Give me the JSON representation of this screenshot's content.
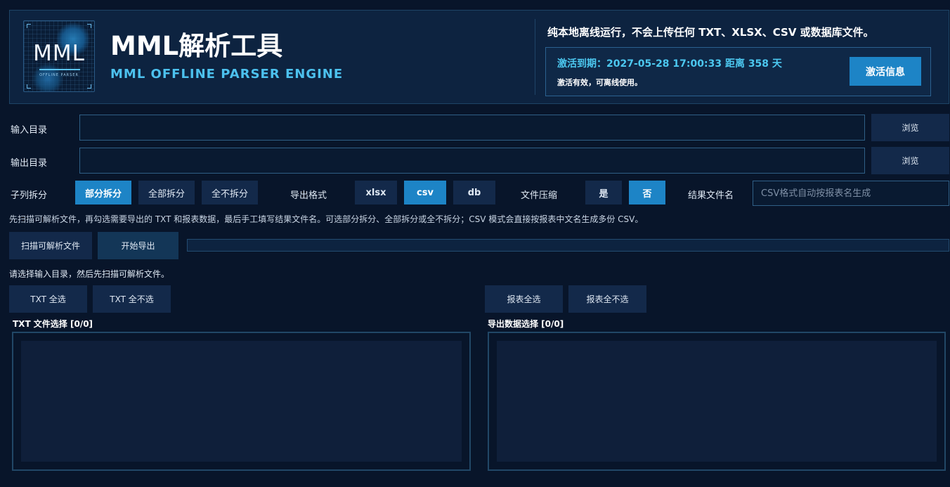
{
  "header": {
    "logo_text": "MML",
    "logo_subtext": "OFFLINE PARSER",
    "title": "MML解析工具",
    "subtitle": "MML OFFLINE PARSER ENGINE",
    "notice": "纯本地离线运行，不会上传任何 TXT、XLSX、CSV 或数据库文件。",
    "activation": {
      "expiry_line": "激活到期：2027-05-28 17:00:33  距离 358 天",
      "status_line": "激活有效，可离线使用。",
      "info_button": "激活信息"
    }
  },
  "form": {
    "input_dir": {
      "label": "输入目录",
      "value": "",
      "browse_label": "浏览"
    },
    "output_dir": {
      "label": "输出目录",
      "value": "",
      "browse_label": "浏览"
    },
    "sub_column_split": {
      "label": "子列拆分",
      "options": [
        "部分拆分",
        "全部拆分",
        "全不拆分"
      ],
      "selected": "部分拆分"
    },
    "export_format": {
      "label": "导出格式",
      "options": [
        "xlsx",
        "csv",
        "db"
      ],
      "selected": "csv"
    },
    "compress": {
      "label": "文件压缩",
      "options": [
        "是",
        "否"
      ],
      "selected": "否"
    },
    "result_filename": {
      "label": "结果文件名",
      "value": "",
      "placeholder": "CSV格式自动按报表名生成"
    }
  },
  "hint": "先扫描可解析文件，再勾选需要导出的 TXT 和报表数据，最后手工填写结果文件名。可选部分拆分、全部拆分或全不拆分；CSV 模式会直接按报表中文名生成多份 CSV。",
  "actions": {
    "scan_label": "扫描可解析文件",
    "export_label": "开始导出",
    "progress": 0
  },
  "status": "请选择输入目录，然后先扫描可解析文件。",
  "txt_panel": {
    "select_all": "TXT 全选",
    "select_none": "TXT 全不选",
    "title": "TXT 文件选择 [0/0]",
    "items": []
  },
  "report_panel": {
    "select_all": "报表全选",
    "select_none": "报表全不选",
    "title": "导出数据选择 [0/0]",
    "items": []
  },
  "colors": {
    "accent": "#1d84c6",
    "subtitle": "#4cc1ee",
    "background": "#08152a"
  }
}
